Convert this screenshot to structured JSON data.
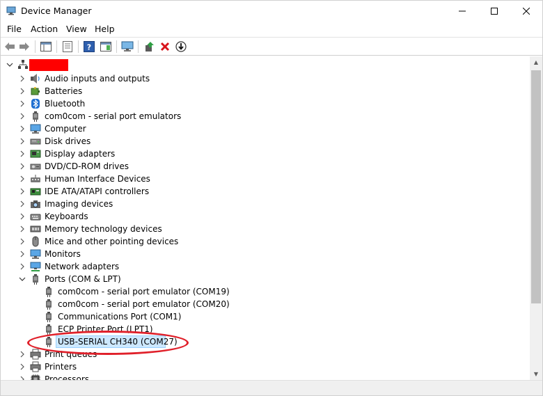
{
  "window": {
    "title": "Device Manager"
  },
  "menu": [
    "File",
    "Action",
    "View",
    "Help"
  ],
  "tree": {
    "categories": [
      {
        "label": "Audio inputs and outputs",
        "icon": "speaker-icon"
      },
      {
        "label": "Batteries",
        "icon": "battery-icon"
      },
      {
        "label": "Bluetooth",
        "icon": "bluetooth-icon"
      },
      {
        "label": "com0com - serial port emulators",
        "icon": "port-icon"
      },
      {
        "label": "Computer",
        "icon": "computer-icon"
      },
      {
        "label": "Disk drives",
        "icon": "disk-icon"
      },
      {
        "label": "Display adapters",
        "icon": "display-adapter-icon"
      },
      {
        "label": "DVD/CD-ROM drives",
        "icon": "dvd-icon"
      },
      {
        "label": "Human Interface Devices",
        "icon": "hid-icon"
      },
      {
        "label": "IDE ATA/ATAPI controllers",
        "icon": "ide-icon"
      },
      {
        "label": "Imaging devices",
        "icon": "camera-icon"
      },
      {
        "label": "Keyboards",
        "icon": "keyboard-icon"
      },
      {
        "label": "Memory technology devices",
        "icon": "memory-icon"
      },
      {
        "label": "Mice and other pointing devices",
        "icon": "mouse-icon"
      },
      {
        "label": "Monitors",
        "icon": "monitor-icon"
      },
      {
        "label": "Network adapters",
        "icon": "network-icon"
      },
      {
        "label": "Ports (COM & LPT)",
        "icon": "port-icon"
      }
    ],
    "ports_children": [
      "com0com - serial port emulator (COM19)",
      "com0com - serial port emulator (COM20)",
      "Communications Port (COM1)",
      "ECP Printer Port (LPT1)",
      "USB-SERIAL CH340 (COM27)"
    ],
    "after": [
      {
        "label": "Print queues",
        "icon": "printer-icon"
      },
      {
        "label": "Printers",
        "icon": "printer-icon"
      },
      {
        "label": "Processors",
        "icon": "processor-icon"
      }
    ]
  }
}
